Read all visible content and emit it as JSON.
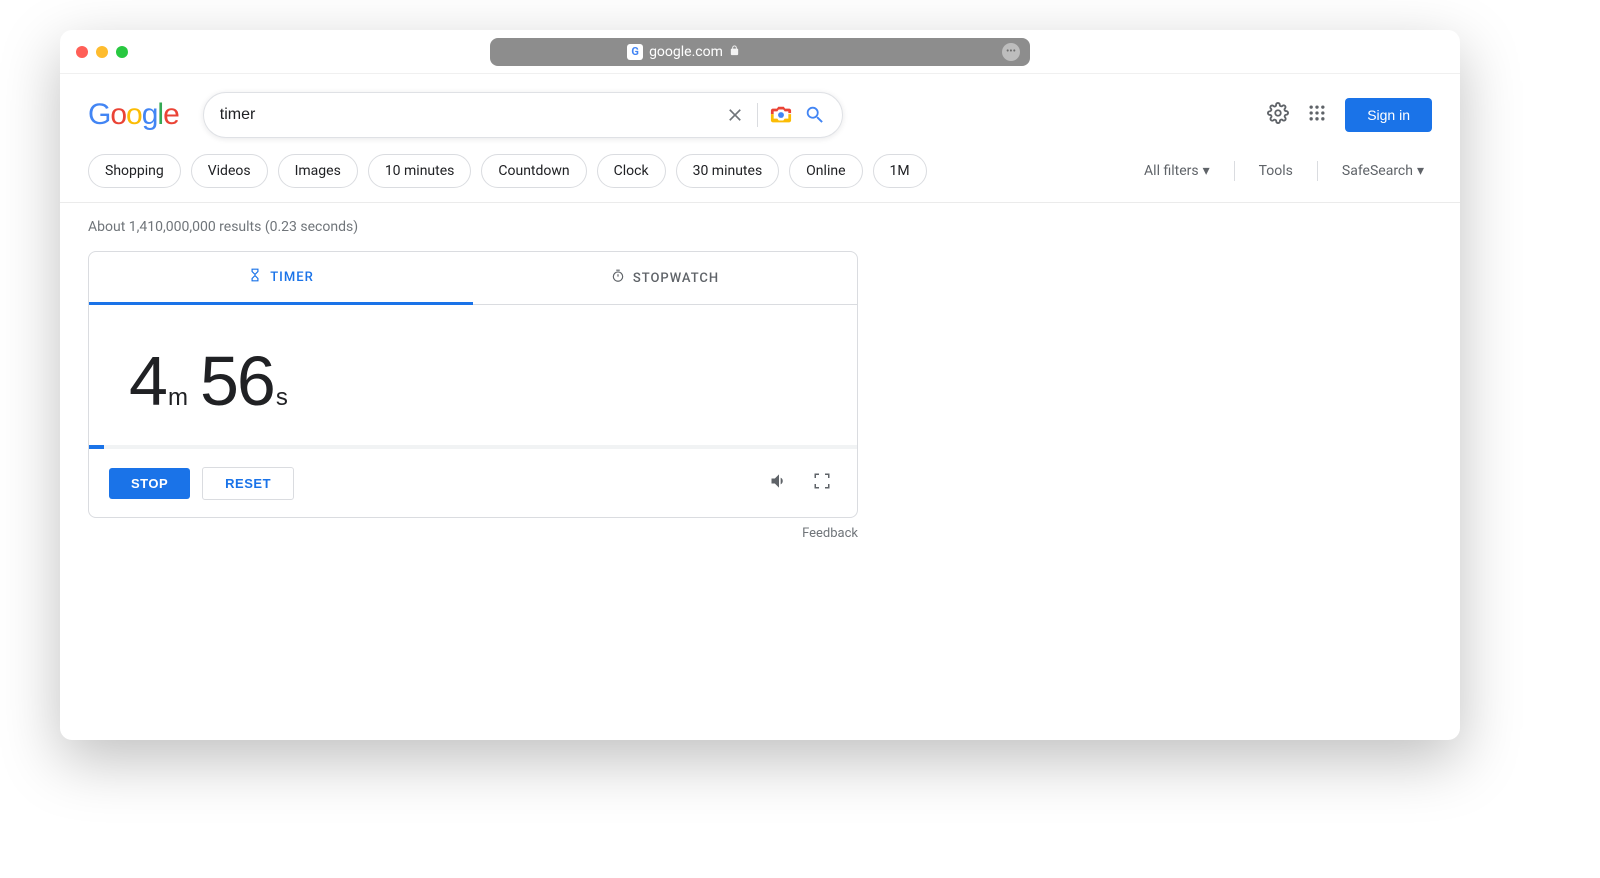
{
  "browser": {
    "domain": "google.com"
  },
  "logo_text": "Google",
  "search": {
    "query": "timer"
  },
  "sign_in_label": "Sign in",
  "chips": [
    "Shopping",
    "Videos",
    "Images",
    "10 minutes",
    "Countdown",
    "Clock",
    "30 minutes",
    "Online",
    "1M"
  ],
  "filters": {
    "all_filters": "All filters",
    "tools": "Tools",
    "safesearch": "SafeSearch"
  },
  "result_stats": "About 1,410,000,000 results (0.23 seconds)",
  "timer": {
    "tab_timer": "TIMER",
    "tab_stopwatch": "STOPWATCH",
    "minutes": "4",
    "minutes_unit": "m",
    "seconds": "56",
    "seconds_unit": "s",
    "stop_label": "STOP",
    "reset_label": "RESET"
  },
  "feedback_label": "Feedback"
}
